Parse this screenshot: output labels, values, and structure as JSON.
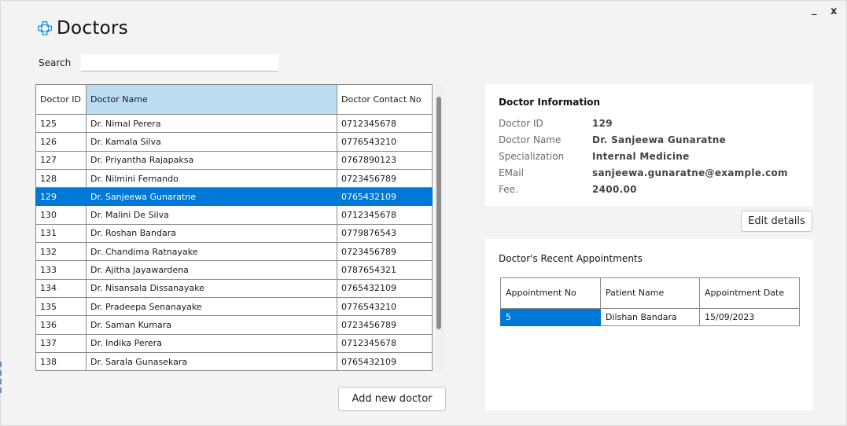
{
  "window": {
    "minimize_label": "_",
    "close_label": "x"
  },
  "header": {
    "title": "Doctors",
    "icon": "medical-cross-icon"
  },
  "search": {
    "label": "Search",
    "value": "",
    "placeholder": ""
  },
  "doctors_table": {
    "headers": {
      "id": "Doctor ID",
      "name": "Doctor Name",
      "contact": "Doctor Contact No"
    },
    "sorted_column": "name",
    "rows": [
      {
        "id": "125",
        "name": "Dr. Nimal Perera",
        "contact": "0712345678"
      },
      {
        "id": "126",
        "name": "Dr. Kamala Silva",
        "contact": "0776543210"
      },
      {
        "id": "127",
        "name": "Dr. Priyantha Rajapaksa",
        "contact": "0767890123"
      },
      {
        "id": "128",
        "name": "Dr. Nilmini Fernando",
        "contact": "0723456789"
      },
      {
        "id": "129",
        "name": "Dr. Sanjeewa Gunaratne",
        "contact": "0765432109"
      },
      {
        "id": "130",
        "name": "Dr. Malini De Silva",
        "contact": "0712345678"
      },
      {
        "id": "131",
        "name": "Dr. Roshan Bandara",
        "contact": "0779876543"
      },
      {
        "id": "132",
        "name": "Dr. Chandima Ratnayake",
        "contact": "0723456789"
      },
      {
        "id": "133",
        "name": "Dr. Ajitha Jayawardena",
        "contact": "0787654321"
      },
      {
        "id": "134",
        "name": "Dr. Nisansala Dissanayake",
        "contact": "0765432109"
      },
      {
        "id": "135",
        "name": "Dr. Pradeepa Senanayake",
        "contact": "0776543210"
      },
      {
        "id": "136",
        "name": "Dr. Saman Kumara",
        "contact": "0723456789"
      },
      {
        "id": "137",
        "name": "Dr. Indika Perera",
        "contact": "0712345678"
      },
      {
        "id": "138",
        "name": "Dr. Sarala Gunasekara",
        "contact": "0765432109"
      }
    ],
    "selected_id": "129"
  },
  "actions": {
    "add_label": "Add new doctor",
    "edit_label": "Edit details"
  },
  "doctor_info": {
    "heading": "Doctor Information",
    "fields": [
      {
        "key": "Doctor ID",
        "value": "129"
      },
      {
        "key": "Doctor Name",
        "value": "Dr. Sanjeewa Gunaratne"
      },
      {
        "key": "Specialization",
        "value": "Internal Medicine"
      },
      {
        "key": "EMail",
        "value": "sanjeewa.gunaratne@example.com"
      },
      {
        "key": "Fee.",
        "value": "2400.00"
      }
    ]
  },
  "appointments": {
    "heading": "Doctor's Recent Appointments",
    "headers": {
      "no": "Appointment No",
      "patient": "Patient Name",
      "date": "Appointment Date"
    },
    "rows": [
      {
        "no": "5",
        "patient": "Dilshan Bandara",
        "date": "15/09/2023"
      }
    ]
  },
  "colors": {
    "accent": "#0078d7",
    "sorted_header": "#bcdcf2",
    "icon": "#1a8fd6"
  }
}
